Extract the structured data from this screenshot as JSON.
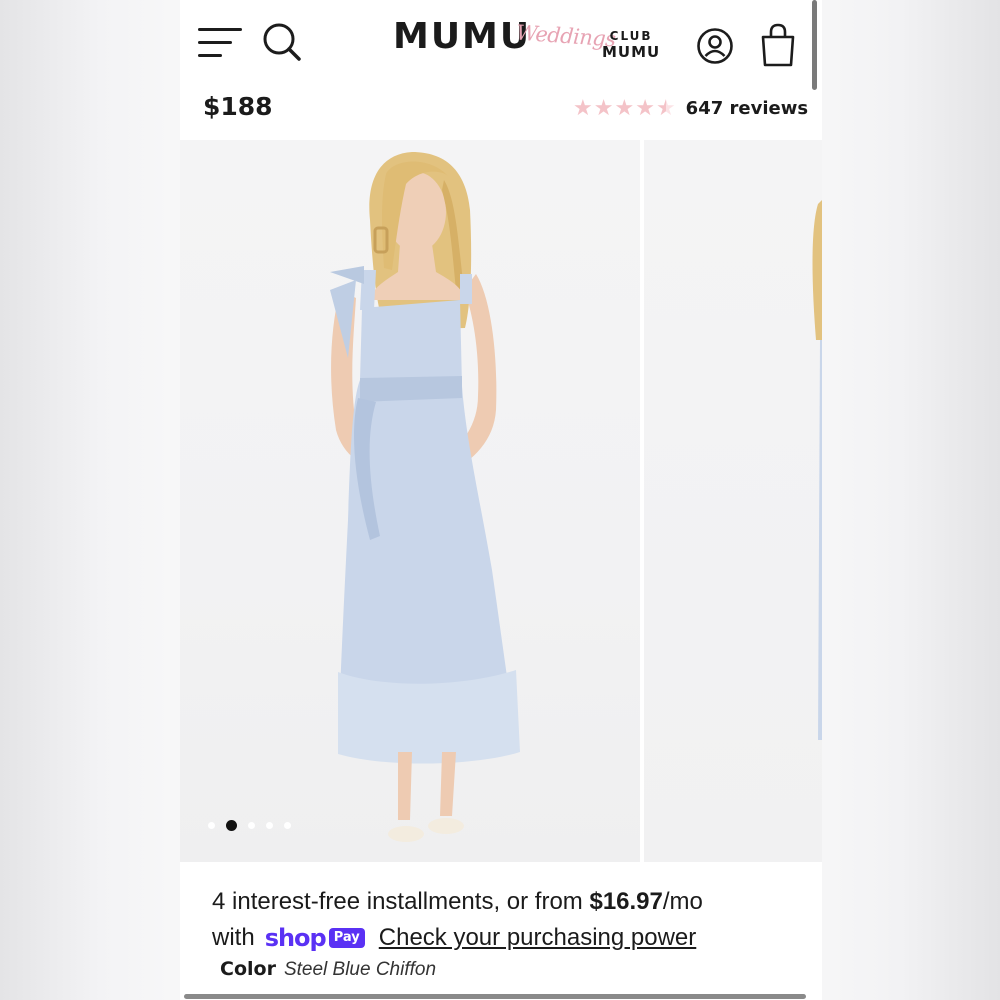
{
  "header": {
    "brand": "MUMU",
    "brand_script": "Weddings",
    "club_line1": "CLUB",
    "club_line2": "MUMU",
    "icons": [
      "menu-icon",
      "search-icon",
      "account-icon",
      "shopping-bag-icon"
    ]
  },
  "product": {
    "price": "$188",
    "rating_stars": 4.5,
    "reviews": "647 reviews"
  },
  "gallery": {
    "slide_count": 5,
    "active_slide": 2
  },
  "installments": {
    "text_prefix": "4 interest-free installments, or from ",
    "amount": "$16.97",
    "text_suffix": "/mo",
    "with": "with",
    "shop_word": "shop",
    "pay_badge": "Pay",
    "link": "Check your purchasing power"
  },
  "color": {
    "label": "Color",
    "value": "Steel Blue Chiffon"
  },
  "colors": {
    "star": "#f4c3c8",
    "shop_pay": "#5a31f4",
    "dress": "#c9d6ea",
    "script_logo": "#e7a3b3"
  }
}
